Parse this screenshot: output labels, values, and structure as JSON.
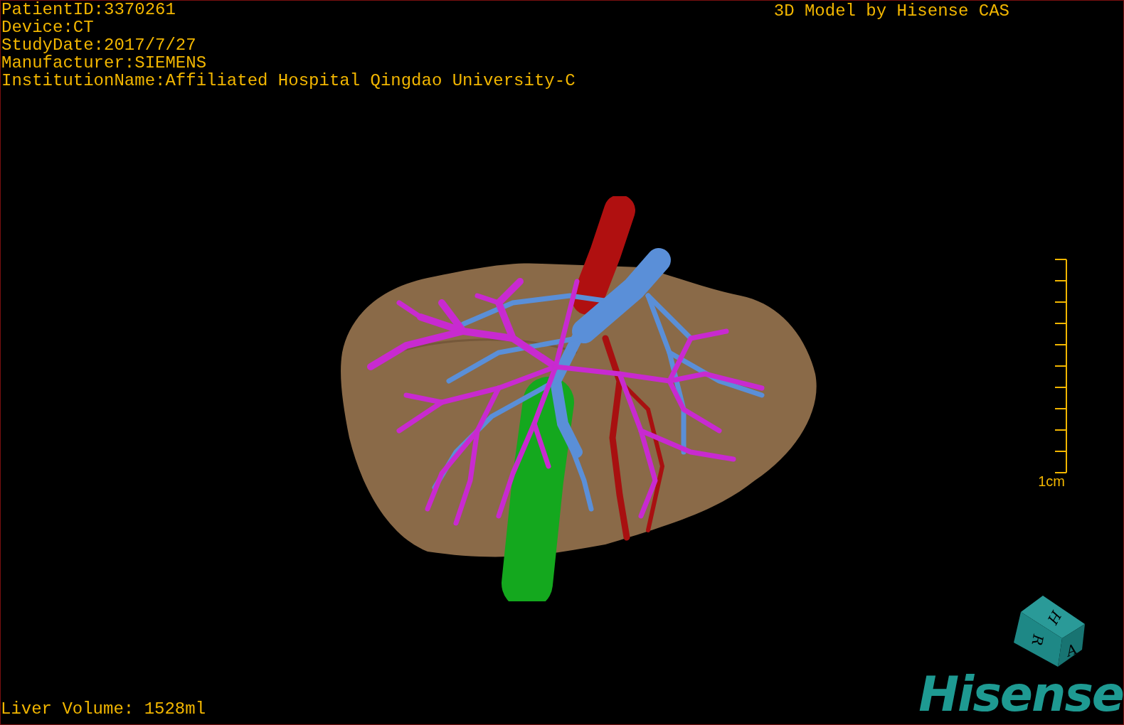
{
  "info_lines": [
    "PatientID:3370261",
    "Device:CT",
    "StudyDate:2017/7/27",
    "Manufacturer:SIEMENS",
    "InstitutionName:Affiliated Hospital Qingdao University-C"
  ],
  "title": "3D Model by Hisense CAS",
  "scale_bar": {
    "label": "1cm"
  },
  "liver_volume": "Liver Volume: 1528ml",
  "orientation_cube": {
    "faces": [
      "H",
      "R",
      "A"
    ]
  },
  "logo": "Hisense"
}
